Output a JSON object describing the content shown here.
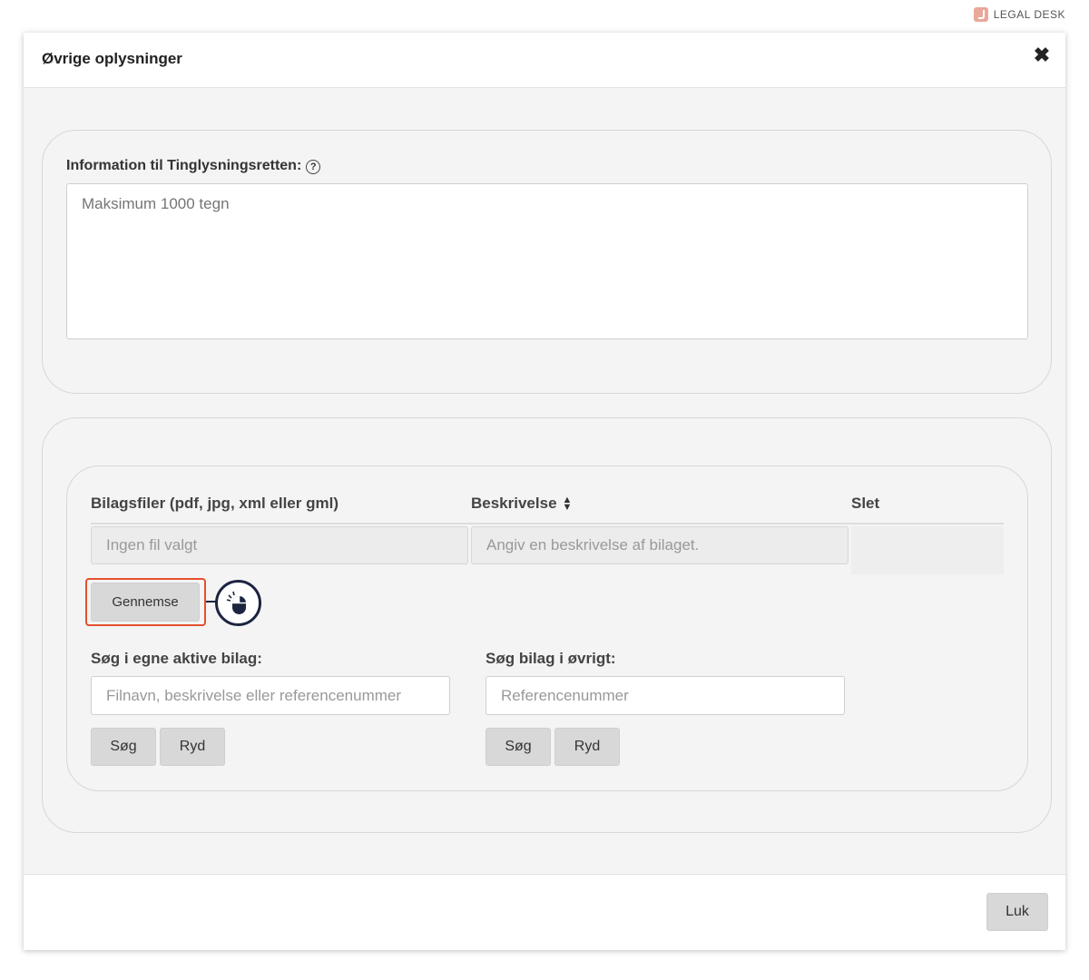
{
  "brand": {
    "name": "LEGAL DESK",
    "logo_icon": "legal-desk-logo-icon",
    "logo_color": "#e8a89a"
  },
  "modal": {
    "title": "Øvrige oplysninger",
    "close_icon": "close-icon",
    "info": {
      "label": "Information til Tinglysningsretten:",
      "help_icon": "?",
      "placeholder": "Maksimum 1000 tegn"
    },
    "attachments": {
      "columns": {
        "file": "Bilagsfiler (pdf, jpg, xml eller gml)",
        "description": "Beskrivelse",
        "delete": "Slet"
      },
      "row": {
        "file_value": "Ingen fil valgt",
        "description_placeholder": "Angiv en beskrivelse af bilaget."
      },
      "browse_label": "Gennemse",
      "highlight_color": "#e4502f",
      "search_own": {
        "label": "Søg i egne aktive bilag:",
        "placeholder": "Filnavn, beskrivelse eller referencenummer",
        "search_label": "Søg",
        "clear_label": "Ryd"
      },
      "search_other": {
        "label": "Søg bilag i øvrigt:",
        "placeholder": "Referencenummer",
        "search_label": "Søg",
        "clear_label": "Ryd"
      }
    },
    "footer": {
      "close_label": "Luk"
    }
  }
}
